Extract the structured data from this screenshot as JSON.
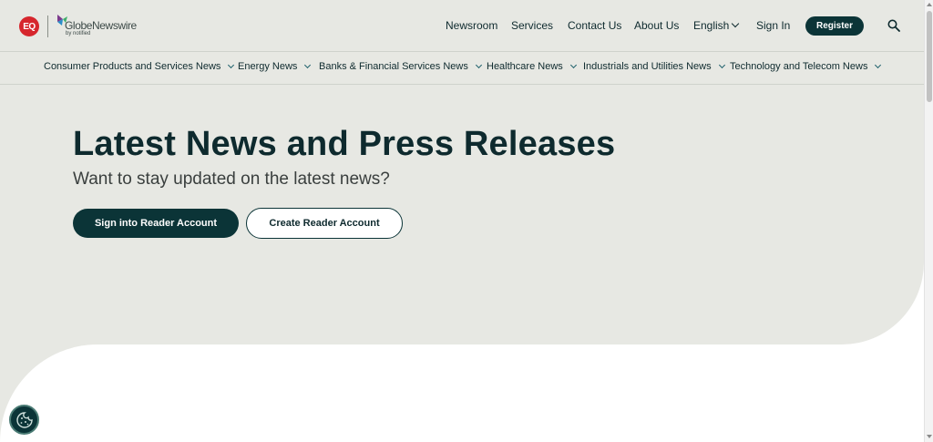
{
  "header": {
    "eq_logo_text": "EQ",
    "brand_name": "GlobeNewswire",
    "brand_sub": "by notified",
    "nav": {
      "newsroom": "Newsroom",
      "services": "Services",
      "contact": "Contact Us",
      "about": "About Us",
      "language": "English",
      "sign_in": "Sign In",
      "register": "Register"
    }
  },
  "categories": [
    "Consumer Products and Services News",
    "Energy News",
    "Banks & Financial Services News",
    "Healthcare News",
    "Industrials and Utilities News",
    "Technology and Telecom News"
  ],
  "hero": {
    "title": "Latest News and Press Releases",
    "subtitle": "Want to stay updated on the latest news?",
    "primary_button": "Sign into Reader Account",
    "secondary_button": "Create Reader Account"
  },
  "colors": {
    "accent_dark": "#0b3437",
    "hero_bg": "#e7e8e3",
    "eq_red": "#d6262d"
  },
  "icons": {
    "search": "search-icon",
    "cookie": "cookie-icon",
    "chevron": "chevron-down-icon"
  }
}
